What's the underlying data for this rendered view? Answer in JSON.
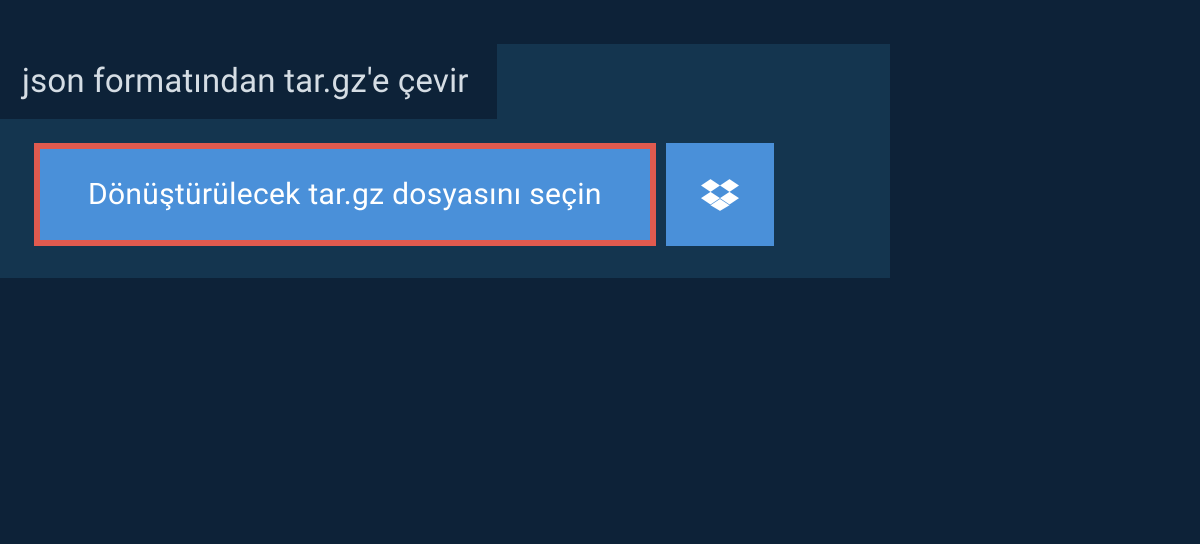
{
  "header": {
    "title": "json formatından tar.gz'e çevir"
  },
  "actions": {
    "select_file_label": "Dönüştürülecek tar.gz dosyasını seçin",
    "dropbox_icon_name": "dropbox-icon"
  },
  "colors": {
    "background": "#0d2238",
    "panel": "#14354f",
    "button": "#4a90d9",
    "button_border": "#e05a4f",
    "text_light": "#d5dde4"
  }
}
